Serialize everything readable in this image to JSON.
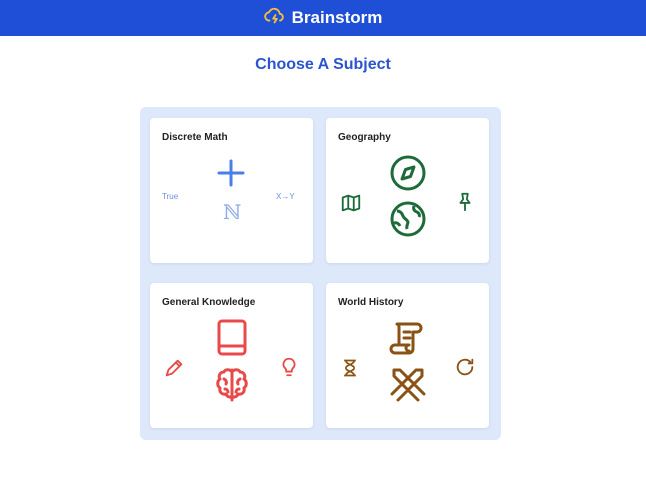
{
  "app": {
    "title": "Brainstorm"
  },
  "page": {
    "heading": "Choose A Subject"
  },
  "subjects": [
    {
      "title": "Discrete Math",
      "icons": [
        "plus-icon",
        "true-text",
        "x-to-y-text",
        "natural-numbers-icon"
      ],
      "true_label": "True",
      "mapping_label": "X→Y",
      "naturals_label": "ℕ",
      "color": "#4a7ee8"
    },
    {
      "title": "Geography",
      "icons": [
        "compass-icon",
        "map-icon",
        "globe-icon",
        "pin-icon"
      ],
      "color": "#1e6b3a"
    },
    {
      "title": "General Knowledge",
      "icons": [
        "book-icon",
        "pencil-icon",
        "brain-icon",
        "lightbulb-icon"
      ],
      "color": "#e84a4a"
    },
    {
      "title": "World History",
      "icons": [
        "scroll-icon",
        "hourglass-icon",
        "swords-icon",
        "refresh-icon"
      ],
      "color": "#8a5214"
    }
  ],
  "colors": {
    "header": "#1f4fd6",
    "heading": "#2b55d0",
    "panel": "#dde8fb",
    "brand_icon": "#f3c238"
  }
}
